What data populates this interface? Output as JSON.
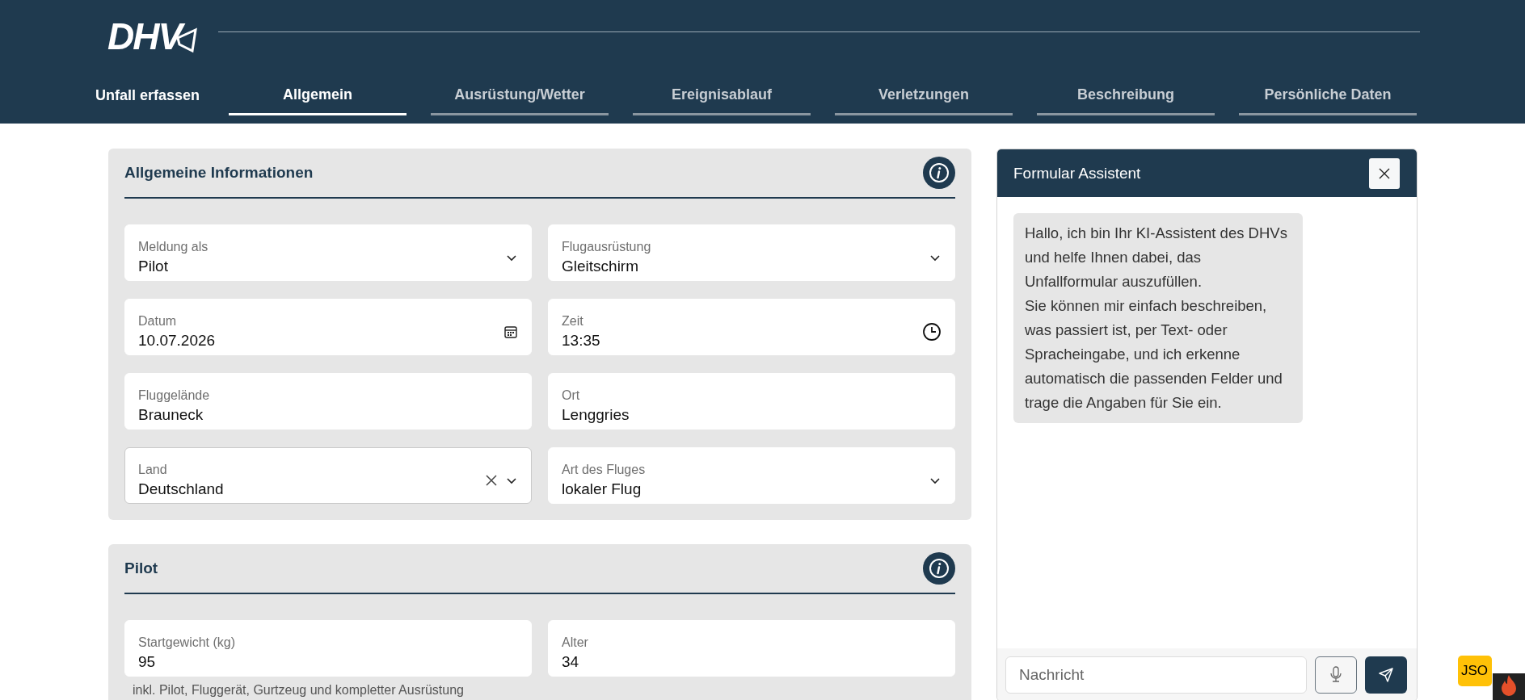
{
  "header": {
    "logo": "DHV",
    "title": "Unfall erfassen"
  },
  "tabs": [
    {
      "label": "Allgemein",
      "selected": true
    },
    {
      "label": "Ausrüstung/Wetter",
      "selected": false
    },
    {
      "label": "Ereignisablauf",
      "selected": false
    },
    {
      "label": "Verletzungen",
      "selected": false
    },
    {
      "label": "Beschreibung",
      "selected": false
    },
    {
      "label": "Persönliche Daten",
      "selected": false
    }
  ],
  "sections": [
    {
      "title": "Allgemeine Informationen",
      "fields": [
        {
          "label": "Meldung als",
          "value": "Pilot",
          "kind": "select"
        },
        {
          "label": "Flugausrüstung",
          "value": "Gleitschirm",
          "kind": "select"
        },
        {
          "label": "Datum",
          "value": "10.07.2026",
          "kind": "date"
        },
        {
          "label": "Zeit",
          "value": "13:35",
          "kind": "time"
        },
        {
          "label": "Fluggelände",
          "value": "Brauneck",
          "kind": "text"
        },
        {
          "label": "Ort",
          "value": "Lenggries",
          "kind": "text"
        },
        {
          "label": "Land",
          "value": "Deutschland",
          "kind": "combobox"
        },
        {
          "label": "Art des Fluges",
          "value": "lokaler Flug",
          "kind": "select"
        }
      ]
    },
    {
      "title": "Pilot",
      "fields": [
        {
          "label": "Startgewicht (kg)",
          "value": "95",
          "kind": "text",
          "hint": "inkl. Pilot, Fluggerät, Gurtzeug und kompletter Ausrüstung"
        },
        {
          "label": "Alter",
          "value": "34",
          "kind": "text"
        }
      ]
    }
  ],
  "assistant": {
    "title": "Formular Assistent",
    "messages": [
      {
        "text": "Hallo, ich bin Ihr KI-Assistent des DHVs und helfe Ihnen dabei, das Unfallformular auszufüllen.\nSie können mir einfach beschreiben, was passiert ist, per Text- oder Spracheingabe, und ich erkenne automatisch die passenden Felder und trage die Angaben für Sie ein."
      }
    ],
    "input": {
      "placeholder": "Nachricht"
    }
  },
  "badge": {
    "label": "JSO"
  }
}
